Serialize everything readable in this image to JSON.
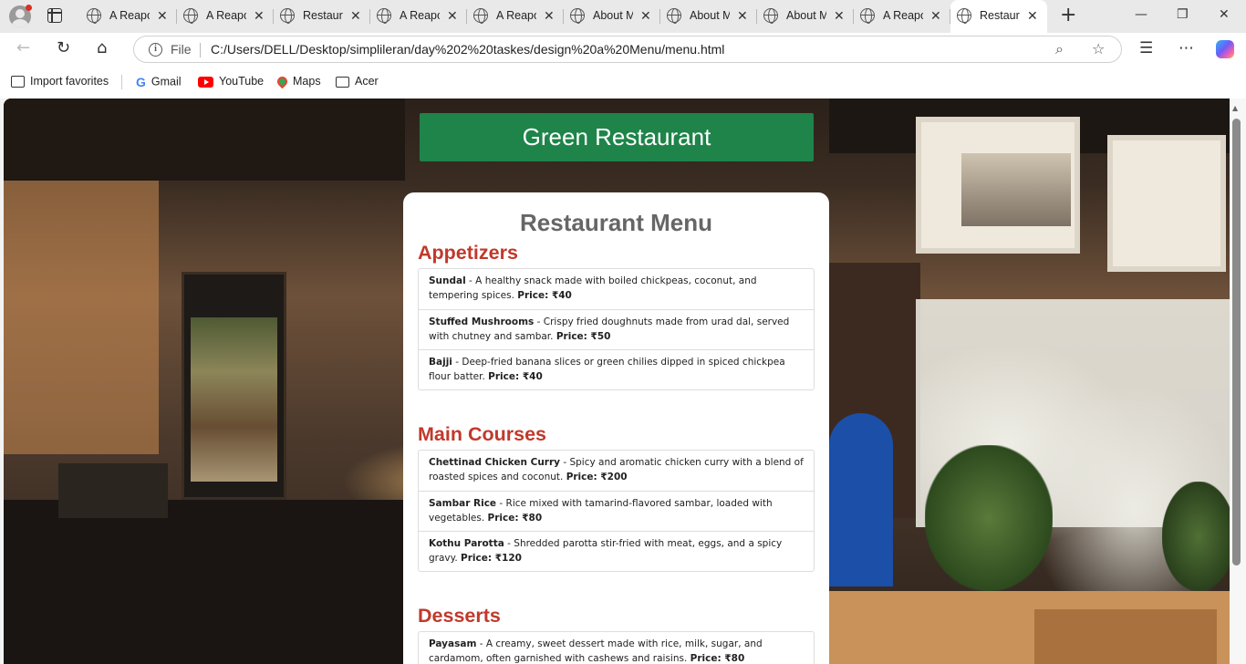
{
  "browser": {
    "tabs": [
      {
        "title": "A Reapo",
        "close": "✕"
      },
      {
        "title": "A Reapo",
        "close": "✕"
      },
      {
        "title": "Restaura",
        "close": "✕"
      },
      {
        "title": "A Reapo",
        "close": "✕"
      },
      {
        "title": "A Reapo",
        "close": "✕"
      },
      {
        "title": "About M",
        "close": "✕"
      },
      {
        "title": "About M",
        "close": "✕"
      },
      {
        "title": "About M",
        "close": "✕"
      },
      {
        "title": "A Reapo",
        "close": "✕"
      },
      {
        "title": "Restaura",
        "close": "✕",
        "active": true
      }
    ],
    "new_tab": "+",
    "window": {
      "minimize": "—",
      "maximize": "❐",
      "close": "✕"
    },
    "address": {
      "scheme": "File",
      "url": "C:/Users/DELL/Desktop/simplileran/day%202%20taskes/design%20a%20Menu/menu.html"
    },
    "bookmarks": [
      {
        "label": "Import favorites",
        "icon": "import-icon"
      },
      {
        "label": "Gmail",
        "icon": "google-icon"
      },
      {
        "label": "YouTube",
        "icon": "youtube-icon"
      },
      {
        "label": "Maps",
        "icon": "maps-pin-icon"
      },
      {
        "label": "Acer",
        "icon": "folder-icon"
      }
    ]
  },
  "page": {
    "header": "Green Restaurant",
    "menu_title": "Restaurant Menu",
    "sections": [
      {
        "title": "Appetizers",
        "items": [
          {
            "name": "Sundal",
            "desc": " - A healthy snack made with boiled chickpeas, coconut, and tempering spices. ",
            "price": "Price: ₹40"
          },
          {
            "name": "Stuffed Mushrooms",
            "desc": " - Crispy fried doughnuts made from urad dal, served with chutney and sambar. ",
            "price": "Price: ₹50"
          },
          {
            "name": "Bajji",
            "desc": " - Deep-fried banana slices or green chilies dipped in spiced chickpea flour batter. ",
            "price": "Price: ₹40"
          }
        ]
      },
      {
        "title": "Main Courses",
        "items": [
          {
            "name": "Chettinad Chicken Curry",
            "desc": " - Spicy and aromatic chicken curry with a blend of roasted spices and coconut. ",
            "price": "Price: ₹200"
          },
          {
            "name": "Sambar Rice",
            "desc": " - Rice mixed with tamarind-flavored sambar, loaded with vegetables. ",
            "price": "Price: ₹80"
          },
          {
            "name": "Kothu Parotta",
            "desc": " - Shredded parotta stir-fried with meat, eggs, and a spicy gravy. ",
            "price": "Price: ₹120"
          }
        ]
      },
      {
        "title": "Desserts",
        "items": [
          {
            "name": "Payasam",
            "desc": " - A creamy, sweet dessert made with rice, milk, sugar, and cardamom, often garnished with cashews and raisins. ",
            "price": "Price: ₹80"
          }
        ]
      }
    ]
  },
  "colors": {
    "header_bg": "#1e8449",
    "section_title": "#c0392b",
    "menu_title": "#666666"
  }
}
